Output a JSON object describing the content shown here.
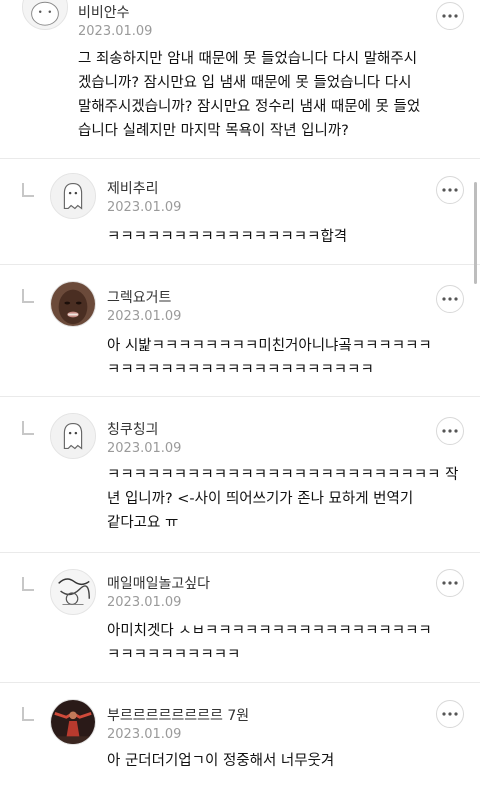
{
  "comments": [
    {
      "name": "비비안수",
      "date": "2023.01.09",
      "lines": [
        "그 죄송하지만 암내 때문에 못 들었습니다 다시 말해주시",
        "겠습니까? 잠시만요 입 냄새 때문에 못 들었습니다 다시",
        "말해주시겠습니까? 잠시만요 정수리 냄새 때문에 못 들었",
        "습니다 실례지만 마지막 목욕이 작년 입니까?"
      ],
      "avatar_icon": "bear-avatar-icon"
    },
    {
      "name": "제비추리",
      "date": "2023.01.09",
      "lines": [
        "ㅋㅋㅋㅋㅋㅋㅋㅋㅋㅋㅋㅋㅋㅋㅋㅋ합격"
      ],
      "avatar_icon": "ghost-avatar-icon"
    },
    {
      "name": "그렉요거트",
      "date": "2023.01.09",
      "lines": [
        "아 시밡ㅋㅋㅋㅋㅋㅋㅋㅋ미친거아니냐곸ㅋㅋㅋㅋㅋㅋ",
        "ㅋㅋㅋㅋㅋㅋㅋㅋㅋㅋㅋㅋㅋㅋㅋㅋㅋㅋㅋㅋ"
      ],
      "avatar_icon": "face-photo-avatar-icon"
    },
    {
      "name": "칭쿠칭긔",
      "date": "2023.01.09",
      "lines": [
        "ㅋㅋㅋㅋㅋㅋㅋㅋㅋㅋㅋㅋㅋㅋㅋㅋㅋㅋㅋㅋㅋㅋㅋㅋㅋ 작",
        "년 입니까? <-사이 띄어쓰기가 존나 묘하게 번역기",
        "같다고요 ㅠ"
      ],
      "avatar_icon": "ghost-avatar-icon"
    },
    {
      "name": "매일매일놀고싶다",
      "date": "2023.01.09",
      "lines": [
        "아미치겟다 ㅅㅂㅋㅋㅋㅋㅋㅋㅋㅋㅋㅋㅋㅋㅋㅋㅋㅋㅋ",
        "ㅋㅋㅋㅋㅋㅋㅋㅋㅋㅋ"
      ],
      "avatar_icon": "drawing-avatar-icon"
    },
    {
      "name": "부르르르르르르르르 7원",
      "date": "2023.01.09",
      "lines": [
        "아 군더더기업ㄱ이 정중해서 너무웃겨"
      ],
      "avatar_icon": "dancer-photo-avatar-icon"
    }
  ],
  "colors": {
    "name": "#333333",
    "date": "#9a9a9a",
    "text": "#111111",
    "divider": "#eaeaea"
  }
}
